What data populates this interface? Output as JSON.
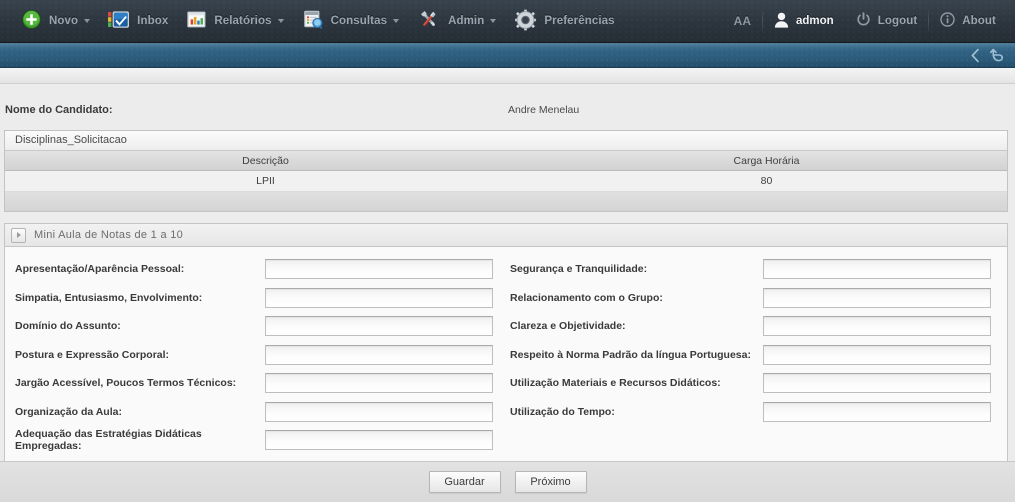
{
  "nav": {
    "items": [
      {
        "label": "Novo",
        "icon": "plus-circle-icon",
        "has_caret": true
      },
      {
        "label": "Inbox",
        "icon": "inbox-checkbox-icon",
        "has_caret": false
      },
      {
        "label": "Relatórios",
        "icon": "bar-chart-icon",
        "has_caret": true
      },
      {
        "label": "Consultas",
        "icon": "document-search-icon",
        "has_caret": true
      },
      {
        "label": "Admin",
        "icon": "tools-icon",
        "has_caret": true
      },
      {
        "label": "Preferências",
        "icon": "gear-icon",
        "has_caret": false
      }
    ],
    "right": {
      "font_size_label": "AA",
      "user": "admon",
      "user_icon": "user-icon",
      "logout": "Logout",
      "logout_icon": "power-icon",
      "about": "About",
      "about_icon": "info-icon"
    }
  },
  "subbar": {
    "back_icon": "chevron-left-icon",
    "refresh_icon": "undo-arrow-icon"
  },
  "candidate": {
    "label": "Nome do Candidato:",
    "value": "Andre Menelau"
  },
  "grid": {
    "title": "Disciplinas_Solicitacao",
    "columns": [
      "Descrição",
      "Carga Horária"
    ],
    "rows": [
      {
        "descricao": "LPII",
        "carga_horaria": "80"
      }
    ]
  },
  "accordion": {
    "title": "Mini Aula de Notas de 1 a 10",
    "toggle_icon": "chevron-right-icon",
    "collapsed": false
  },
  "form": {
    "left_fields": [
      {
        "label": "Apresentação/Aparência Pessoal:",
        "value": ""
      },
      {
        "label": "Simpatia, Entusiasmo, Envolvimento:",
        "value": ""
      },
      {
        "label": "Domínio do Assunto:",
        "value": ""
      },
      {
        "label": "Postura e Expressão Corporal:",
        "value": ""
      },
      {
        "label": "Jargão Acessível, Poucos Termos Técnicos:",
        "value": ""
      },
      {
        "label": "Organização da Aula:",
        "value": ""
      },
      {
        "label": "Adequação das Estratégias Didáticas Empregadas:",
        "value": ""
      }
    ],
    "right_fields": [
      {
        "label": "Segurança e Tranquilidade:",
        "value": ""
      },
      {
        "label": "Relacionamento com o Grupo:",
        "value": ""
      },
      {
        "label": "Clareza e Objetividade:",
        "value": ""
      },
      {
        "label": "Respeito à Norma Padrão da língua Portuguesa:",
        "value": ""
      },
      {
        "label": "Utilização Materiais e Recursos Didáticos:",
        "value": ""
      },
      {
        "label": "Utilização do Tempo:",
        "value": ""
      }
    ]
  },
  "footer": {
    "save_label": "Guardar",
    "next_label": "Próximo"
  },
  "colors": {
    "topbar": "#2c353e",
    "subbar": "#2b5a79",
    "page_bg": "#ececec",
    "panel_bg": "#fafafa",
    "accent_green": "#3a9b2f"
  }
}
